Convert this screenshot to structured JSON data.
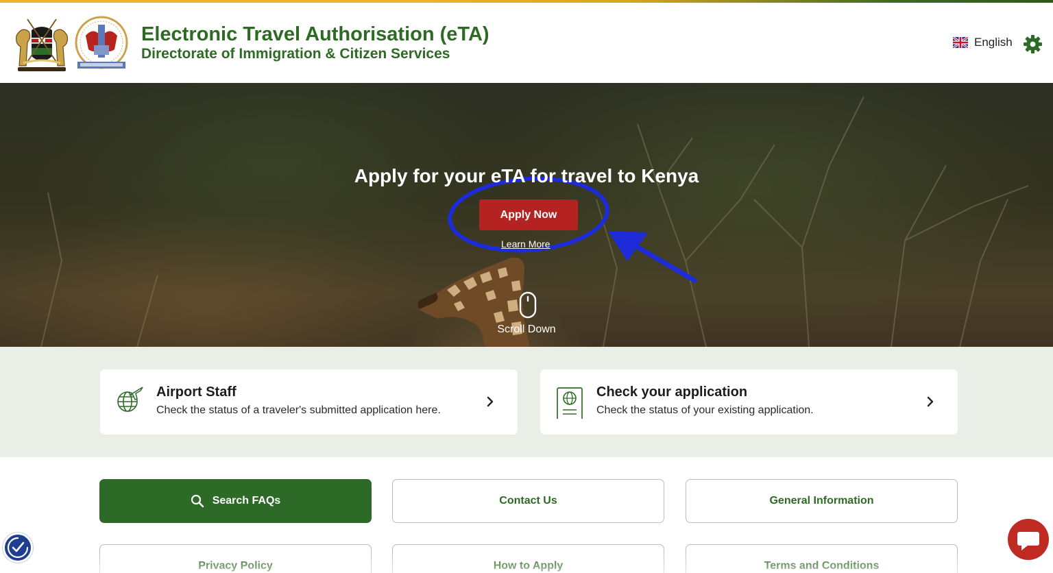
{
  "header": {
    "title": "Electronic Travel Authorisation (eTA)",
    "subtitle": "Directorate of Immigration & Citizen Services",
    "language": "English",
    "colors": {
      "brand_green": "#2d6a23",
      "stripe_gold": "#f0b22a"
    },
    "icons": [
      "kenya-coat-of-arms-icon",
      "immigration-emblem-icon",
      "uk-flag-icon",
      "gear-icon"
    ]
  },
  "hero": {
    "title": "Apply for your eTA for travel to Kenya",
    "apply_label": "Apply Now",
    "learn_more_label": "Learn More",
    "scroll_label": "Scroll Down",
    "colors": {
      "apply_button": "#b52222",
      "annotation": "#1d2bd8"
    }
  },
  "cards": [
    {
      "title": "Airport Staff",
      "description": "Check the status of a traveler's submitted application here.",
      "icon": "globe-plane-icon"
    },
    {
      "title": "Check your application",
      "description": "Check the status of your existing application.",
      "icon": "passport-icon"
    }
  ],
  "links": [
    {
      "label": "Search FAQs",
      "icon": "search-icon",
      "style": "primary"
    },
    {
      "label": "Contact Us"
    },
    {
      "label": "General Information"
    },
    {
      "label": "Privacy Policy"
    },
    {
      "label": "How to Apply"
    },
    {
      "label": "Terms and Conditions"
    }
  ],
  "floating": {
    "accessibility_icon": "accessibility-icon",
    "chat_icon": "chat-icon"
  }
}
